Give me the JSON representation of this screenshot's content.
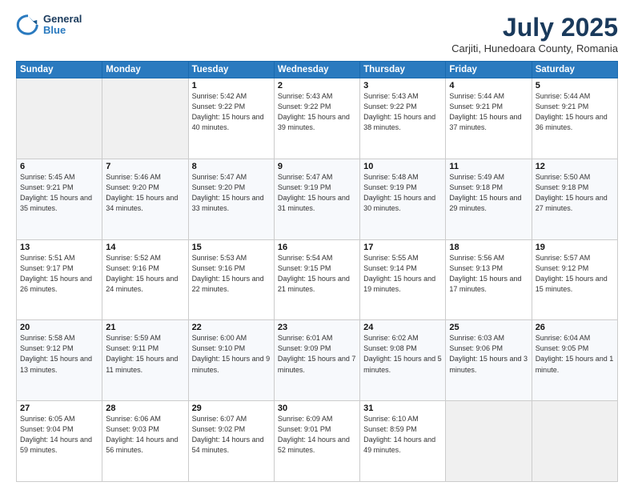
{
  "header": {
    "logo_general": "General",
    "logo_blue": "Blue",
    "month_year": "July 2025",
    "location": "Carjiti, Hunedoara County, Romania"
  },
  "days_of_week": [
    "Sunday",
    "Monday",
    "Tuesday",
    "Wednesday",
    "Thursday",
    "Friday",
    "Saturday"
  ],
  "weeks": [
    [
      {
        "day": "",
        "sunrise": "",
        "sunset": "",
        "daylight": ""
      },
      {
        "day": "",
        "sunrise": "",
        "sunset": "",
        "daylight": ""
      },
      {
        "day": "1",
        "sunrise": "Sunrise: 5:42 AM",
        "sunset": "Sunset: 9:22 PM",
        "daylight": "Daylight: 15 hours and 40 minutes."
      },
      {
        "day": "2",
        "sunrise": "Sunrise: 5:43 AM",
        "sunset": "Sunset: 9:22 PM",
        "daylight": "Daylight: 15 hours and 39 minutes."
      },
      {
        "day": "3",
        "sunrise": "Sunrise: 5:43 AM",
        "sunset": "Sunset: 9:22 PM",
        "daylight": "Daylight: 15 hours and 38 minutes."
      },
      {
        "day": "4",
        "sunrise": "Sunrise: 5:44 AM",
        "sunset": "Sunset: 9:21 PM",
        "daylight": "Daylight: 15 hours and 37 minutes."
      },
      {
        "day": "5",
        "sunrise": "Sunrise: 5:44 AM",
        "sunset": "Sunset: 9:21 PM",
        "daylight": "Daylight: 15 hours and 36 minutes."
      }
    ],
    [
      {
        "day": "6",
        "sunrise": "Sunrise: 5:45 AM",
        "sunset": "Sunset: 9:21 PM",
        "daylight": "Daylight: 15 hours and 35 minutes."
      },
      {
        "day": "7",
        "sunrise": "Sunrise: 5:46 AM",
        "sunset": "Sunset: 9:20 PM",
        "daylight": "Daylight: 15 hours and 34 minutes."
      },
      {
        "day": "8",
        "sunrise": "Sunrise: 5:47 AM",
        "sunset": "Sunset: 9:20 PM",
        "daylight": "Daylight: 15 hours and 33 minutes."
      },
      {
        "day": "9",
        "sunrise": "Sunrise: 5:47 AM",
        "sunset": "Sunset: 9:19 PM",
        "daylight": "Daylight: 15 hours and 31 minutes."
      },
      {
        "day": "10",
        "sunrise": "Sunrise: 5:48 AM",
        "sunset": "Sunset: 9:19 PM",
        "daylight": "Daylight: 15 hours and 30 minutes."
      },
      {
        "day": "11",
        "sunrise": "Sunrise: 5:49 AM",
        "sunset": "Sunset: 9:18 PM",
        "daylight": "Daylight: 15 hours and 29 minutes."
      },
      {
        "day": "12",
        "sunrise": "Sunrise: 5:50 AM",
        "sunset": "Sunset: 9:18 PM",
        "daylight": "Daylight: 15 hours and 27 minutes."
      }
    ],
    [
      {
        "day": "13",
        "sunrise": "Sunrise: 5:51 AM",
        "sunset": "Sunset: 9:17 PM",
        "daylight": "Daylight: 15 hours and 26 minutes."
      },
      {
        "day": "14",
        "sunrise": "Sunrise: 5:52 AM",
        "sunset": "Sunset: 9:16 PM",
        "daylight": "Daylight: 15 hours and 24 minutes."
      },
      {
        "day": "15",
        "sunrise": "Sunrise: 5:53 AM",
        "sunset": "Sunset: 9:16 PM",
        "daylight": "Daylight: 15 hours and 22 minutes."
      },
      {
        "day": "16",
        "sunrise": "Sunrise: 5:54 AM",
        "sunset": "Sunset: 9:15 PM",
        "daylight": "Daylight: 15 hours and 21 minutes."
      },
      {
        "day": "17",
        "sunrise": "Sunrise: 5:55 AM",
        "sunset": "Sunset: 9:14 PM",
        "daylight": "Daylight: 15 hours and 19 minutes."
      },
      {
        "day": "18",
        "sunrise": "Sunrise: 5:56 AM",
        "sunset": "Sunset: 9:13 PM",
        "daylight": "Daylight: 15 hours and 17 minutes."
      },
      {
        "day": "19",
        "sunrise": "Sunrise: 5:57 AM",
        "sunset": "Sunset: 9:12 PM",
        "daylight": "Daylight: 15 hours and 15 minutes."
      }
    ],
    [
      {
        "day": "20",
        "sunrise": "Sunrise: 5:58 AM",
        "sunset": "Sunset: 9:12 PM",
        "daylight": "Daylight: 15 hours and 13 minutes."
      },
      {
        "day": "21",
        "sunrise": "Sunrise: 5:59 AM",
        "sunset": "Sunset: 9:11 PM",
        "daylight": "Daylight: 15 hours and 11 minutes."
      },
      {
        "day": "22",
        "sunrise": "Sunrise: 6:00 AM",
        "sunset": "Sunset: 9:10 PM",
        "daylight": "Daylight: 15 hours and 9 minutes."
      },
      {
        "day": "23",
        "sunrise": "Sunrise: 6:01 AM",
        "sunset": "Sunset: 9:09 PM",
        "daylight": "Daylight: 15 hours and 7 minutes."
      },
      {
        "day": "24",
        "sunrise": "Sunrise: 6:02 AM",
        "sunset": "Sunset: 9:08 PM",
        "daylight": "Daylight: 15 hours and 5 minutes."
      },
      {
        "day": "25",
        "sunrise": "Sunrise: 6:03 AM",
        "sunset": "Sunset: 9:06 PM",
        "daylight": "Daylight: 15 hours and 3 minutes."
      },
      {
        "day": "26",
        "sunrise": "Sunrise: 6:04 AM",
        "sunset": "Sunset: 9:05 PM",
        "daylight": "Daylight: 15 hours and 1 minute."
      }
    ],
    [
      {
        "day": "27",
        "sunrise": "Sunrise: 6:05 AM",
        "sunset": "Sunset: 9:04 PM",
        "daylight": "Daylight: 14 hours and 59 minutes."
      },
      {
        "day": "28",
        "sunrise": "Sunrise: 6:06 AM",
        "sunset": "Sunset: 9:03 PM",
        "daylight": "Daylight: 14 hours and 56 minutes."
      },
      {
        "day": "29",
        "sunrise": "Sunrise: 6:07 AM",
        "sunset": "Sunset: 9:02 PM",
        "daylight": "Daylight: 14 hours and 54 minutes."
      },
      {
        "day": "30",
        "sunrise": "Sunrise: 6:09 AM",
        "sunset": "Sunset: 9:01 PM",
        "daylight": "Daylight: 14 hours and 52 minutes."
      },
      {
        "day": "31",
        "sunrise": "Sunrise: 6:10 AM",
        "sunset": "Sunset: 8:59 PM",
        "daylight": "Daylight: 14 hours and 49 minutes."
      },
      {
        "day": "",
        "sunrise": "",
        "sunset": "",
        "daylight": ""
      },
      {
        "day": "",
        "sunrise": "",
        "sunset": "",
        "daylight": ""
      }
    ]
  ]
}
